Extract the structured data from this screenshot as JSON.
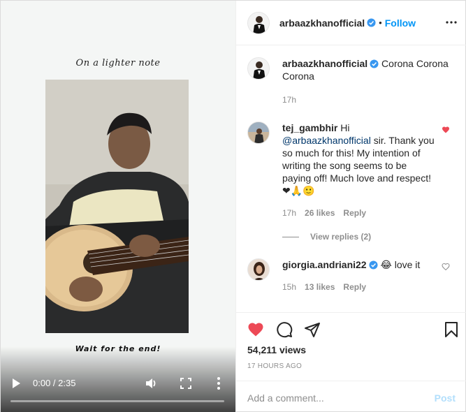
{
  "video": {
    "caption_top": "On a lighter note",
    "caption_bottom": "Wait for the end!",
    "time": "0:00 / 2:35",
    "progress": 0
  },
  "post": {
    "author": "arbaazkhanofficial",
    "follow_label": "Follow",
    "separator": "•",
    "caption": "Corona Corona Corona",
    "caption_time": "17h",
    "views": "54,211 views",
    "posted_ago": "17 HOURS AGO"
  },
  "comments": [
    {
      "user": "tej_gambhir",
      "text_prefix": "Hi ",
      "mention": "@arbaazkhanofficial",
      "text_suffix": " sir. Thank you so much for this! My intention of writing the song seems to be paying off! Much love and respect!",
      "emojis": "❤🙏🙂",
      "time": "17h",
      "likes": "26 likes",
      "reply_label": "Reply",
      "liked": true,
      "view_replies": "View replies (2)"
    },
    {
      "user": "giorgia.andriani22",
      "emoji": "😂",
      "text": "love it",
      "time": "15h",
      "likes": "13 likes",
      "reply_label": "Reply",
      "liked": false
    }
  ],
  "add_comment": {
    "placeholder": "Add a comment...",
    "post_label": "Post"
  },
  "colors": {
    "verified": "#3897f0",
    "like": "#ed4956",
    "link": "#0095f6"
  }
}
